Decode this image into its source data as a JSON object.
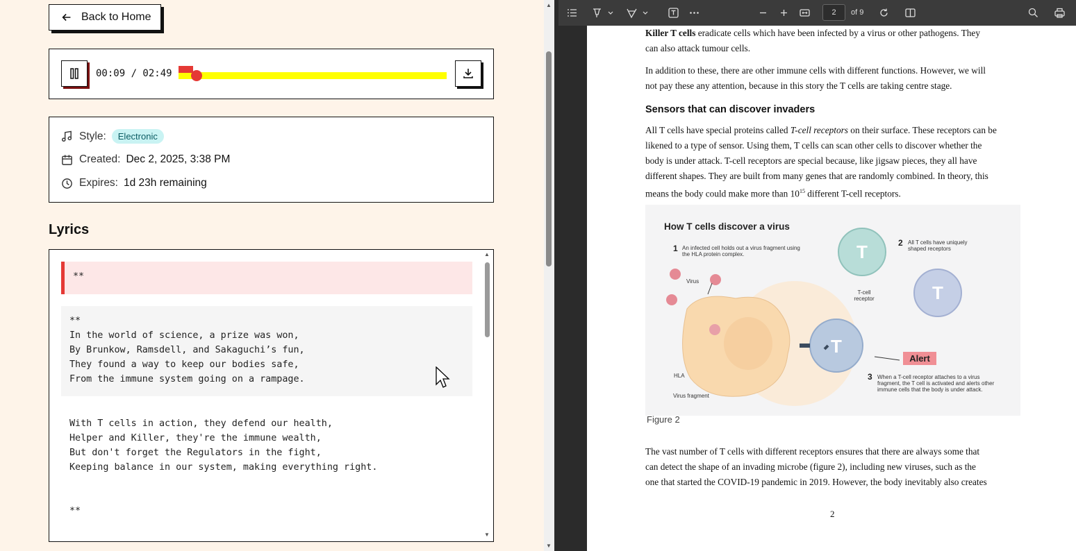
{
  "app": {
    "back_label": "Back to Home",
    "player": {
      "time_display": "00:09 / 02:49",
      "progress_fraction": 0.0533
    },
    "meta": {
      "style_label": "Style:",
      "style_value": "Electronic",
      "created_label": "Created:",
      "created_value": "Dec 2, 2025, 3:38 PM",
      "expires_label": "Expires:",
      "expires_value": "1d 23h remaining"
    },
    "lyrics": {
      "heading": "Lyrics",
      "sec1": "**",
      "sec2": "**\nIn the world of science, a prize was won,\nBy Brunkow, Ramsdell, and Sakaguchi’s fun,\nThey found a way to keep our bodies safe,\nFrom the immune system going on a rampage.",
      "sec3": "With T cells in action, they defend our health,\nHelper and Killer, they're the immune wealth,\nBut don't forget the Regulators in the fight,\nKeeping balance in our system, making everything right.",
      "sec4": "**"
    }
  },
  "pdf": {
    "page_input": "2",
    "page_of": "of 9",
    "page_number": "2",
    "para1_bold": "Killer T cells",
    "para1_rest": " eradicate cells which have been infected by a virus or other pathogens. They",
    "para1_line2": "can also attack tumour cells.",
    "para2_line1": "In addition to these, there are other immune cells with different functions. However, we will",
    "para2_line2": "not pay these any attention, because in this story the T cells are taking centre stage.",
    "heading": "Sensors that can discover invaders",
    "para3_l1a": "All T cells have special proteins called ",
    "para3_l1i": "T-cell receptors",
    "para3_l1b": " on their surface. These receptors can be",
    "para3_l2": "likened to a type of sensor. Using them, T cells can scan other cells to discover whether the",
    "para3_l3": "body is under attack. T-cell receptors are special because, like jigsaw pieces, they all have",
    "para3_l4": "different shapes. They are built from many genes that are randomly combined. In theory, this",
    "para3_l5a": "means the body could make more than 10",
    "para3_l5sup": "15",
    "para3_l5b": " different T-cell receptors.",
    "figure": {
      "title": "How T cells discover a virus",
      "n1": "1",
      "t1": "An infected cell holds out a virus fragment using the HLA protein complex.",
      "n2": "2",
      "t2": "All T cells have uniquely shaped receptors",
      "n3": "3",
      "t3": "When a T-cell receptor attaches to a virus fragment, the T cell is activated and alerts other immune cells that the body is under attack.",
      "virus": "Virus",
      "tcr": "T-cell receptor",
      "hla": "HLA",
      "vfrag": "Virus fragment",
      "alert": "Alert",
      "t_letter": "T"
    },
    "caption": "Figure 2",
    "para4_l1": "The vast number of T cells with different receptors ensures that there are always some that",
    "para4_l2": "can detect the shape of an invading microbe (figure 2), including new viruses, such as the",
    "para4_l3": "one that started the COVID-19 pandemic in 2019. However, the body inevitably also creates"
  }
}
